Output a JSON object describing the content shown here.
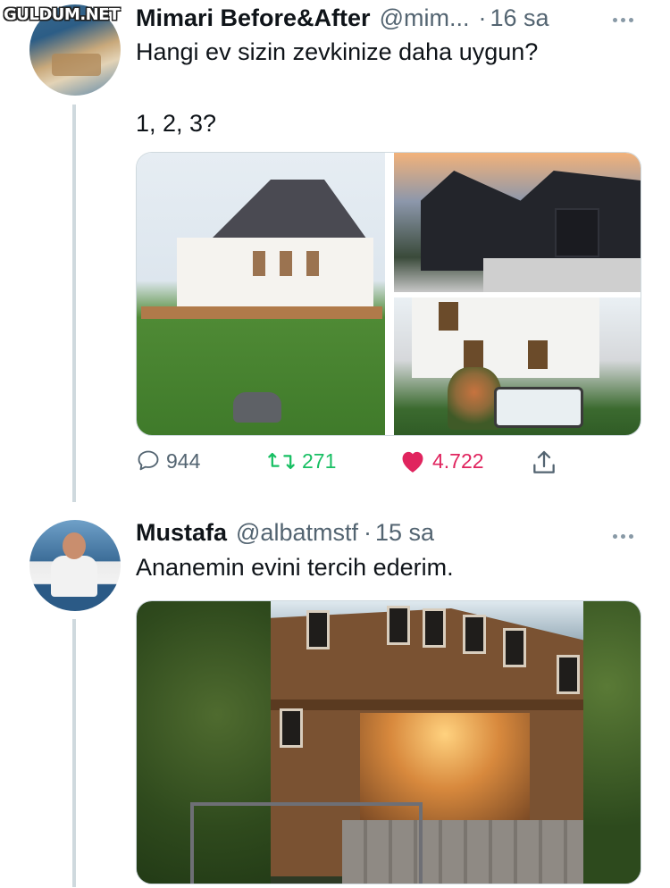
{
  "watermark": "GULDUM.NET",
  "tweets": [
    {
      "author": {
        "name": "Mimari Before&After",
        "handle": "@mim...",
        "time": "16 sa",
        "separator": "·"
      },
      "lines": [
        "Hangi ev sizin zevkinize daha uygun?",
        "1, 2, 3?"
      ],
      "media_count": 3,
      "actions": {
        "replies": "944",
        "retweets": "271",
        "likes": "4.722"
      }
    },
    {
      "author": {
        "name": "Mustafa",
        "handle": "@albatmstf",
        "time": "15 sa",
        "separator": "·"
      },
      "lines": [
        "Ananemin evini tercih ederim."
      ],
      "media_count": 1
    }
  ],
  "icons": {
    "reply": "speech-bubble-icon",
    "retweet": "retweet-icon",
    "like": "heart-icon",
    "share": "share-icon",
    "more": "ellipsis-icon"
  },
  "colors": {
    "retweet": "#17bf63",
    "like": "#e0245e",
    "secondary_text": "#536471",
    "thread_line": "#cfd9de"
  }
}
